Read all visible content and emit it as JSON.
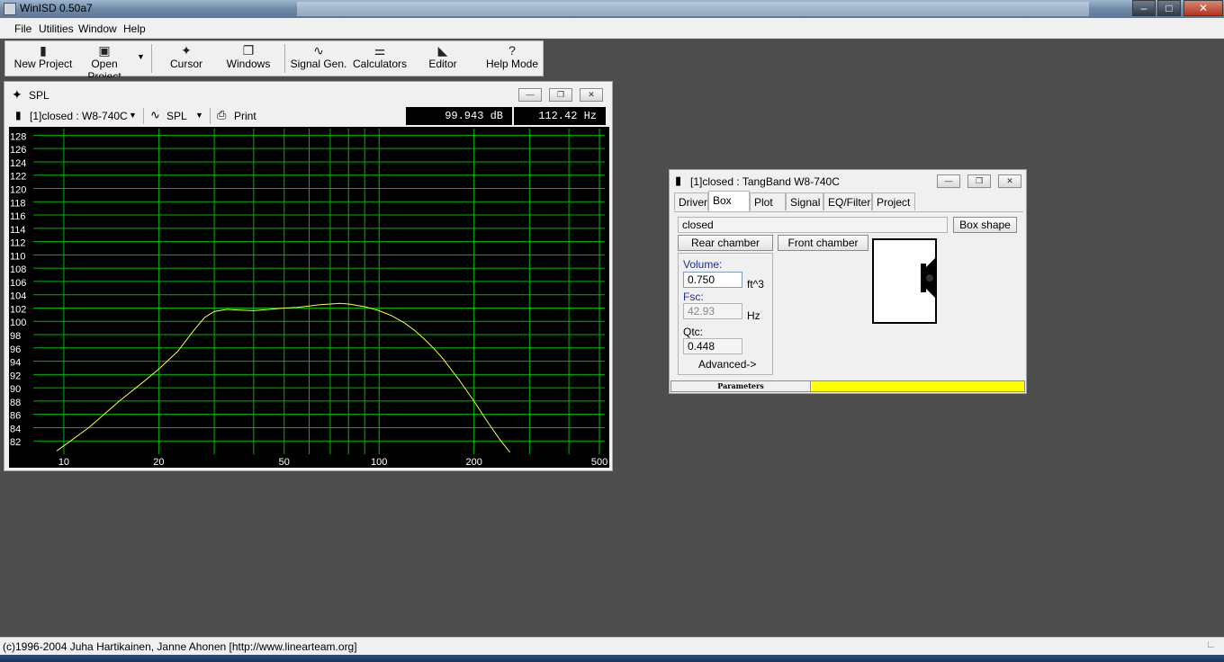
{
  "app": {
    "title": "WinISD 0.50a7"
  },
  "menu": [
    {
      "label": "File"
    },
    {
      "label": "Utilities"
    },
    {
      "label": "Window"
    },
    {
      "label": "Help"
    }
  ],
  "toolbar": {
    "new_project": "New Project",
    "open_project": "Open Project",
    "cursor": "Cursor",
    "windows": "Windows",
    "signal_gen": "Signal Gen.",
    "calculators": "Calculators",
    "editor": "Editor",
    "help_mode": "Help Mode"
  },
  "spl_window": {
    "title": "SPL",
    "project_select": "[1]closed : W8-740C",
    "plot_select": "SPL",
    "print_label": "Print",
    "readout_db": "99.943 dB",
    "readout_hz": "112.42 Hz"
  },
  "chart_data": {
    "type": "line",
    "title": "",
    "xlabel": "",
    "ylabel": "",
    "x_scale": "log",
    "xlim": [
      8,
      520
    ],
    "ylim": [
      80,
      129
    ],
    "x_ticks": [
      10,
      20,
      50,
      100,
      200,
      500
    ],
    "y_ticks": [
      82,
      84,
      86,
      88,
      90,
      92,
      94,
      96,
      98,
      100,
      102,
      104,
      106,
      108,
      110,
      112,
      114,
      116,
      118,
      120,
      122,
      124,
      126,
      128
    ],
    "grid": true,
    "colors": {
      "background": "#000000",
      "grid": "#00b400",
      "curve": "#ffff33",
      "ticks": "#ffffff"
    },
    "series": [
      {
        "x": [
          9.5,
          12,
          15,
          18,
          20,
          23,
          26,
          28,
          30,
          33,
          36,
          40,
          45,
          50,
          55,
          60,
          65,
          70,
          75,
          80,
          85,
          90,
          95,
          100,
          110,
          120,
          130,
          140,
          150,
          160,
          180,
          200,
          220,
          240,
          260
        ],
        "y": [
          80.5,
          84,
          88,
          91,
          92.8,
          95.5,
          98.8,
          100.6,
          101.5,
          101.8,
          101.7,
          101.6,
          101.8,
          102.0,
          102.1,
          102.3,
          102.5,
          102.6,
          102.7,
          102.6,
          102.4,
          102.2,
          101.9,
          101.6,
          100.8,
          99.8,
          98.6,
          97.2,
          95.8,
          94.3,
          91.1,
          88.0,
          85.0,
          82.4,
          80.3
        ]
      }
    ]
  },
  "box_window": {
    "title": "[1]closed : TangBand W8-740C",
    "tabs": [
      "Driver",
      "Box",
      "Plot",
      "Signal",
      "EQ/Filter",
      "Project"
    ],
    "active_tab": "Box",
    "box_type": "closed",
    "box_shape_button": "Box shape",
    "rear_chamber_button": "Rear chamber",
    "front_chamber_button": "Front chamber",
    "volume_label": "Volume:",
    "volume_value": "0.750",
    "volume_unit": "ft^3",
    "fsc_label": "Fsc:",
    "fsc_value": "42.93",
    "fsc_unit": "Hz",
    "qtc_label": "Qtc:",
    "qtc_value": "0.448",
    "advanced_label": "Advanced->",
    "status_label": "Parameters",
    "status_color": "#ffff00"
  },
  "statusbar": {
    "text": "(c)1996-2004 Juha Hartikainen, Janne Ahonen [http://www.linearteam.org]"
  }
}
